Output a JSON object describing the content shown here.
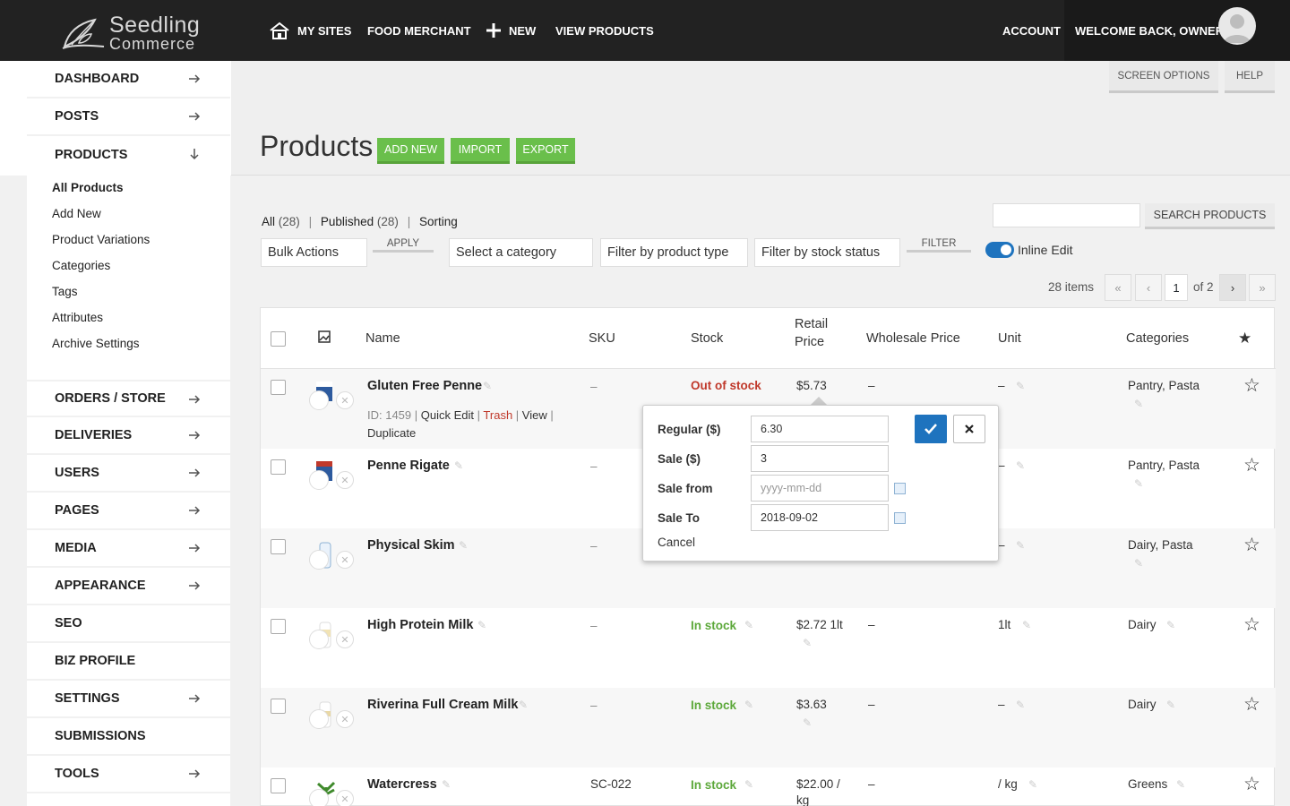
{
  "brand": {
    "line1": "Seedling",
    "line2": "Commerce"
  },
  "topnav": {
    "my_sites": "MY SITES",
    "food_merchant": "FOOD MERCHANT",
    "new": "NEW",
    "view_products": "VIEW PRODUCTS",
    "account": "ACCOUNT",
    "welcome": "WELCOME BACK, OWNER"
  },
  "sidebar": {
    "items": [
      {
        "label": "DASHBOARD",
        "arrow": "right"
      },
      {
        "label": "POSTS",
        "arrow": "right"
      },
      {
        "label": "PRODUCTS",
        "arrow": "down"
      },
      {
        "label": "ORDERS / STORE",
        "arrow": "right"
      },
      {
        "label": "DELIVERIES",
        "arrow": "right"
      },
      {
        "label": "USERS",
        "arrow": "right"
      },
      {
        "label": "PAGES",
        "arrow": "right"
      },
      {
        "label": "MEDIA",
        "arrow": "right"
      },
      {
        "label": "APPEARANCE",
        "arrow": "right"
      },
      {
        "label": "SEO",
        "arrow": ""
      },
      {
        "label": "BIZ PROFILE",
        "arrow": ""
      },
      {
        "label": "SETTINGS",
        "arrow": "right"
      },
      {
        "label": "SUBMISSIONS",
        "arrow": ""
      },
      {
        "label": "TOOLS",
        "arrow": "right"
      }
    ],
    "submenu": [
      "All Products",
      "Add New",
      "Product Variations",
      "Categories",
      "Tags",
      "Attributes",
      "Archive Settings"
    ]
  },
  "header": {
    "screen_options": "SCREEN OPTIONS",
    "help": "HELP",
    "title": "Products",
    "add_new": "ADD NEW",
    "import": "IMPORT",
    "export": "EXPORT"
  },
  "filters": {
    "all": "All",
    "all_count": "(28)",
    "published": "Published",
    "published_count": "(28)",
    "sorting": "Sorting",
    "bulk_actions": "Bulk Actions",
    "apply": "APPLY",
    "category": "Select a category",
    "product_type": "Filter by product type",
    "stock_status": "Filter by stock status",
    "filter": "FILTER",
    "search_button": "SEARCH PRODUCTS",
    "search_value": "",
    "inline_edit": "Inline Edit",
    "items": "28 items",
    "first": "«",
    "prev": "‹",
    "page": "1",
    "of": "of 2",
    "next": "›",
    "last": "»"
  },
  "table": {
    "headers": {
      "name": "Name",
      "sku": "SKU",
      "stock": "Stock",
      "retail_1": "Retail",
      "retail_2": "Price",
      "wholesale": "Wholesale Price",
      "unit": "Unit",
      "categories": "Categories"
    },
    "rows": [
      {
        "name": "Gluten Free Penne",
        "sku": "–",
        "stock": "Out of stock",
        "stock_status": "out",
        "price": "$5.73",
        "wholesale": "–",
        "unit": "–",
        "categories": "Pantry, Pasta",
        "row_id": "ID: 1459",
        "quick_edit": "Quick Edit",
        "trash": "Trash",
        "view": "View",
        "duplicate": "Duplicate"
      },
      {
        "name": "Penne Rigate",
        "sku": "–",
        "stock": "",
        "stock_status": "",
        "price": "",
        "wholesale": "",
        "unit": "–",
        "categories": "Pantry, Pasta"
      },
      {
        "name": "Physical Skim",
        "sku": "–",
        "stock": "",
        "stock_status": "",
        "price": "",
        "wholesale": "",
        "unit": "–",
        "categories": "Dairy, Pasta"
      },
      {
        "name": "High Protein Milk",
        "sku": "–",
        "stock": "In stock",
        "stock_status": "in",
        "price": "$2.72 1lt",
        "wholesale": "–",
        "unit": "1lt",
        "categories": "Dairy"
      },
      {
        "name": "Riverina Full Cream Milk",
        "sku": "–",
        "stock": "In stock",
        "stock_status": "in",
        "price": "$3.63",
        "wholesale": "–",
        "unit": "–",
        "categories": "Dairy"
      },
      {
        "name": "Watercress",
        "sku": "SC-022",
        "stock": "In stock",
        "stock_status": "in",
        "price_1": "$22.00 /",
        "price_2": "kg",
        "wholesale": "–",
        "unit": "/ kg",
        "categories": "Greens"
      }
    ]
  },
  "price_popup": {
    "regular_label": "Regular ($)",
    "regular_value": "6.30",
    "sale_label": "Sale ($)",
    "sale_value": "3",
    "sale_from_label": "Sale from",
    "sale_from_placeholder": "yyyy-mm-dd",
    "sale_to_label": "Sale To",
    "sale_to_value": "2018-09-02",
    "cancel": "Cancel"
  },
  "colors": {
    "topbar": "#222222",
    "accent_green": "#6abf4b",
    "accent_blue": "#1e73be",
    "out_of_stock": "#c0392b",
    "in_stock": "#5ca83a"
  }
}
